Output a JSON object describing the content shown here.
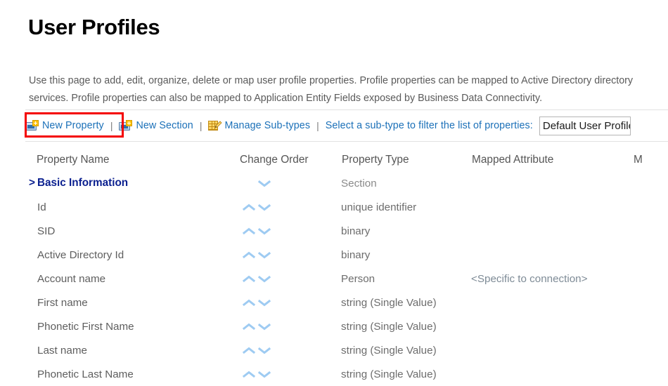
{
  "page": {
    "title": "User Profiles",
    "description": "Use this page to add, edit, organize, delete or map user profile properties. Profile properties can be mapped to Active Directory directory services. Profile properties can also be mapped to Application Entity Fields exposed by Business Data Connectivity."
  },
  "toolbar": {
    "new_property": "New Property",
    "new_section": "New Section",
    "manage_subtypes": "Manage Sub-types",
    "separator": "|",
    "subtype_filter_label": "Select a sub-type to filter the list of properties:",
    "subtype_selected": "Default User Profile Subtype",
    "highlight_color": "#f40000",
    "link_color": "#1b70b8"
  },
  "table": {
    "headers": {
      "property_name": "Property Name",
      "change_order": "Change Order",
      "property_type": "Property Type",
      "mapped_attribute": "Mapped Attribute",
      "multivalue": "M"
    },
    "rows": [
      {
        "name": "Basic Information",
        "caret": ">",
        "is_section": true,
        "order_up": false,
        "order_down": true,
        "type": "Section",
        "mapped": "",
        "multi": ""
      },
      {
        "name": "Id",
        "caret": "",
        "is_section": false,
        "order_up": true,
        "order_down": true,
        "type": "unique identifier",
        "mapped": "",
        "multi": ""
      },
      {
        "name": "SID",
        "caret": "",
        "is_section": false,
        "order_up": true,
        "order_down": true,
        "type": "binary",
        "mapped": "",
        "multi": ""
      },
      {
        "name": "Active Directory Id",
        "caret": "",
        "is_section": false,
        "order_up": true,
        "order_down": true,
        "type": "binary",
        "mapped": "",
        "multi": ""
      },
      {
        "name": "Account name",
        "caret": "",
        "is_section": false,
        "order_up": true,
        "order_down": true,
        "type": "Person",
        "mapped": "<Specific to connection>",
        "multi": ""
      },
      {
        "name": "First name",
        "caret": "",
        "is_section": false,
        "order_up": true,
        "order_down": true,
        "type": "string (Single Value)",
        "mapped": "",
        "multi": ""
      },
      {
        "name": "Phonetic First Name",
        "caret": "",
        "is_section": false,
        "order_up": true,
        "order_down": true,
        "type": "string (Single Value)",
        "mapped": "",
        "multi": ""
      },
      {
        "name": "Last name",
        "caret": "",
        "is_section": false,
        "order_up": true,
        "order_down": true,
        "type": "string (Single Value)",
        "mapped": "",
        "multi": ""
      },
      {
        "name": "Phonetic Last Name",
        "caret": "",
        "is_section": false,
        "order_up": true,
        "order_down": true,
        "type": "string (Single Value)",
        "mapped": "",
        "multi": ""
      }
    ]
  },
  "icons": {
    "new_property": "new-item-icon",
    "new_section": "new-item-icon",
    "manage_subtypes": "grid-pencil-icon",
    "move_up": "chevron-up-icon",
    "move_down": "chevron-down-icon"
  }
}
